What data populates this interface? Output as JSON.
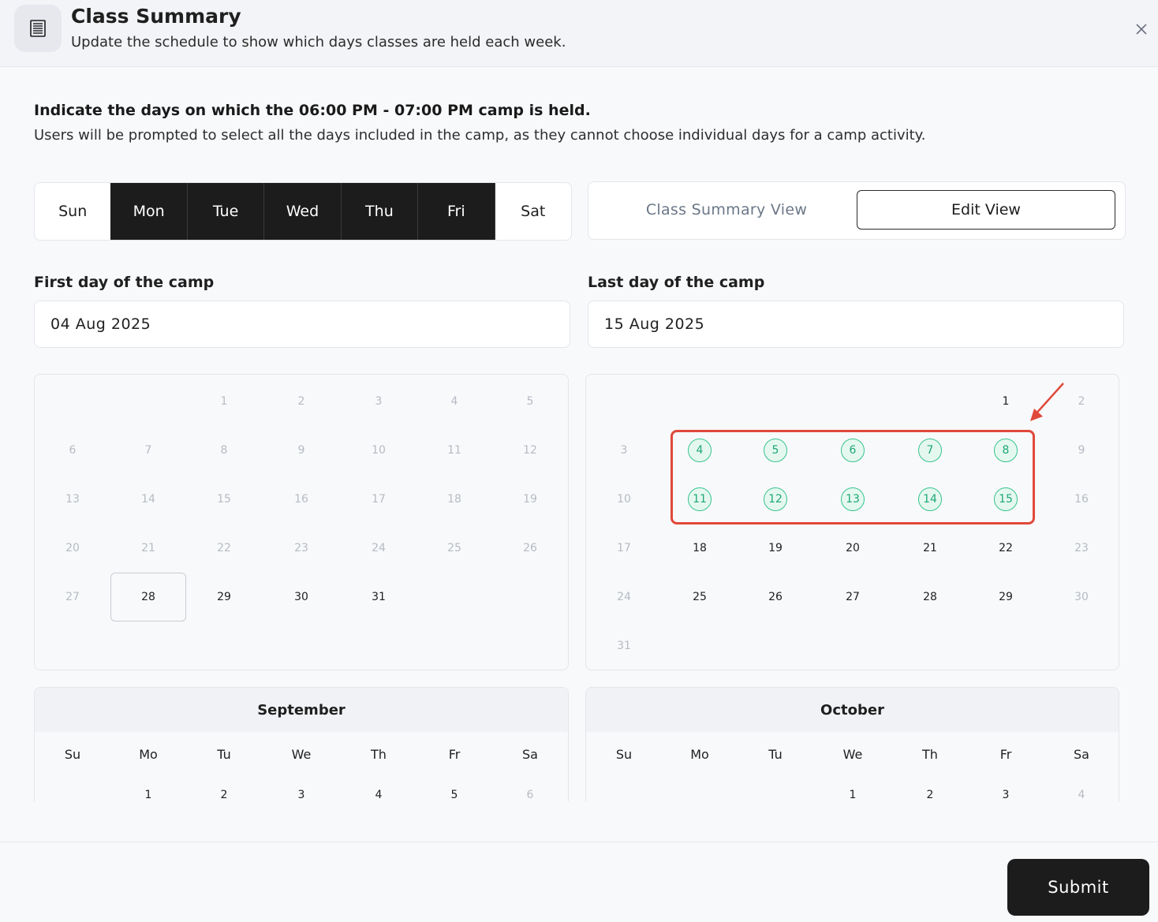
{
  "header": {
    "title": "Class Summary",
    "subtitle": "Update the schedule to show which days classes are held each week.",
    "icon": "document-list-icon",
    "close_icon": "close-icon"
  },
  "intro": {
    "heading": "Indicate the days on which the 06:00 PM - 07:00 PM camp is held.",
    "text": "Users will be prompted to select all the days included in the camp, as they cannot choose individual days for a camp activity."
  },
  "days": [
    {
      "label": "Sun",
      "selected": false
    },
    {
      "label": "Mon",
      "selected": true
    },
    {
      "label": "Tue",
      "selected": true
    },
    {
      "label": "Wed",
      "selected": true
    },
    {
      "label": "Thu",
      "selected": true
    },
    {
      "label": "Fri",
      "selected": true
    },
    {
      "label": "Sat",
      "selected": false
    }
  ],
  "view_toggle": {
    "summary_label": "Class Summary View",
    "edit_label": "Edit View"
  },
  "first_day": {
    "label": "First day of the camp",
    "value": "04 Aug 2025"
  },
  "last_day": {
    "label": "Last day of the camp",
    "value": "15 Aug 2025"
  },
  "calendars": {
    "july": {
      "weeks": [
        [
          "",
          "",
          "1",
          "2",
          "3",
          "4",
          "5"
        ],
        [
          "6",
          "7",
          "8",
          "9",
          "10",
          "11",
          "12"
        ],
        [
          "13",
          "14",
          "15",
          "16",
          "17",
          "18",
          "19"
        ],
        [
          "20",
          "21",
          "22",
          "23",
          "24",
          "25",
          "26"
        ],
        [
          "27",
          "28",
          "29",
          "30",
          "31",
          "",
          ""
        ]
      ]
    },
    "august": {
      "weeks": [
        [
          "",
          "",
          "",
          "",
          "",
          "1",
          "2"
        ],
        [
          "3",
          "4",
          "5",
          "6",
          "7",
          "8",
          "9"
        ],
        [
          "10",
          "11",
          "12",
          "13",
          "14",
          "15",
          "16"
        ],
        [
          "17",
          "18",
          "19",
          "20",
          "21",
          "22",
          "23"
        ],
        [
          "24",
          "25",
          "26",
          "27",
          "28",
          "29",
          "30"
        ],
        [
          "31",
          "",
          "",
          "",
          "",
          "",
          ""
        ]
      ],
      "highlighted": [
        "4",
        "5",
        "6",
        "7",
        "8",
        "11",
        "12",
        "13",
        "14",
        "15"
      ]
    },
    "september": {
      "name": "September",
      "weekdays": [
        "Su",
        "Mo",
        "Tu",
        "We",
        "Th",
        "Fr",
        "Sa"
      ],
      "first_row": [
        "",
        "1",
        "2",
        "3",
        "4",
        "5",
        "6"
      ]
    },
    "october": {
      "name": "October",
      "weekdays": [
        "Su",
        "Mo",
        "Tu",
        "We",
        "Th",
        "Fr",
        "Sa"
      ],
      "first_row": [
        "",
        "",
        "",
        "1",
        "2",
        "3",
        "4"
      ]
    }
  },
  "footer": {
    "submit_label": "Submit"
  },
  "colors": {
    "accent_dark": "#1c1c1c",
    "highlight_green": "#36c48e",
    "annotation_red": "#e0493a"
  }
}
